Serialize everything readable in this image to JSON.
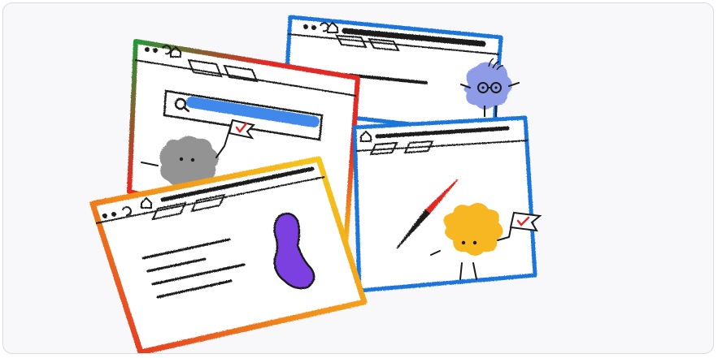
{
  "illustration": {
    "colors": {
      "background": "#f8f8fa",
      "blue": "#1f74d8",
      "red": "#e02b25",
      "green": "#1f9a3a",
      "yellow": "#f6d21a",
      "orange": "#f08a1c",
      "purple": "#7b3fe0",
      "gray_blob": "#8a8a8a",
      "lavender_blob": "#8e9ce8",
      "orange_blob": "#f6b722",
      "ink": "#1b1b1b"
    },
    "icons": [
      "browser-window-blue-back",
      "browser-window-chrome",
      "browser-window-safari",
      "browser-window-firefox",
      "search-icon",
      "home-icon",
      "reload-icon",
      "compass-icon",
      "checkmark-flag-icon"
    ]
  }
}
